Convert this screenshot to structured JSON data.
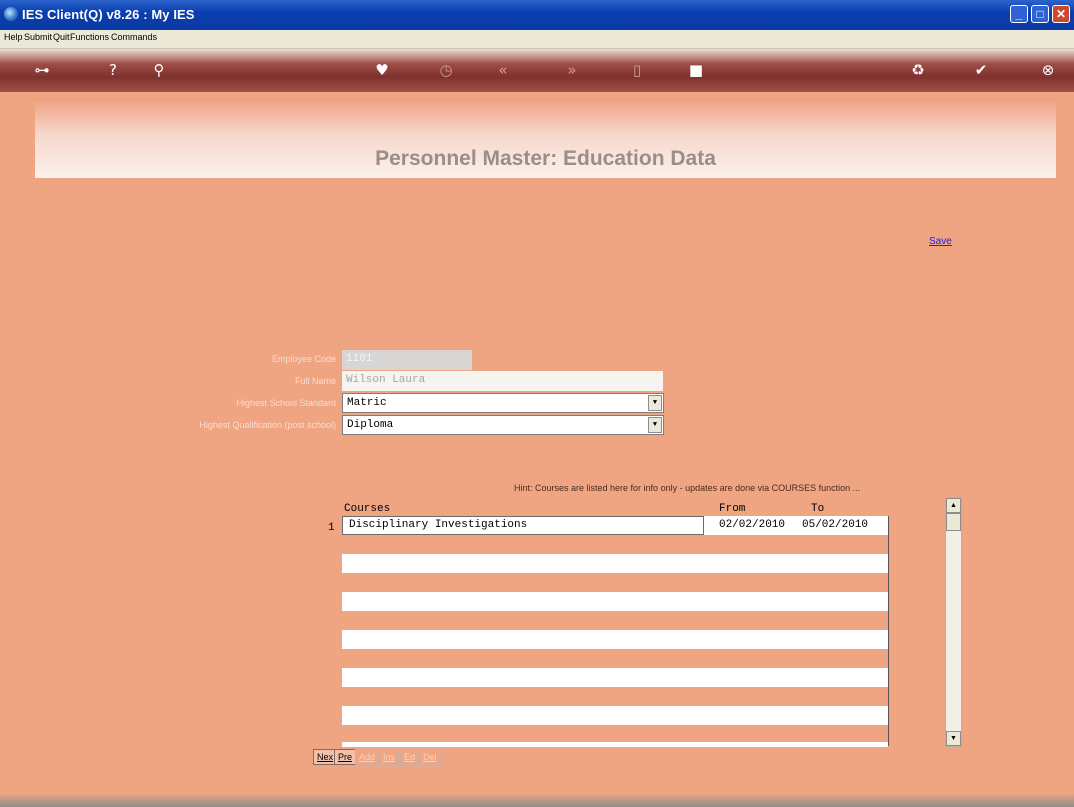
{
  "window": {
    "title": "IES Client(Q) v8.26 : My IES"
  },
  "menu": [
    "Help",
    "Submit",
    "Quit",
    "Functions",
    "Commands"
  ],
  "toolbar": {
    "icons": [
      "key-icon",
      "help-icon",
      "search-icon",
      "heart-icon",
      "clock-icon",
      "rewind-icon",
      "fast-forward-icon",
      "trash-icon",
      "document-icon",
      "recycle-icon",
      "check-icon",
      "close-circle-icon"
    ]
  },
  "page": {
    "title": "Personnel Master: Education Data",
    "save_label": "Save"
  },
  "form": {
    "employee_code_label": "Employee Code",
    "employee_code_value": "1101",
    "full_name_label": "Full Name",
    "full_name_value": "Wilson Laura",
    "school_label": "Highest School Standard",
    "school_value": "Matric",
    "qualification_label": "Highest Qualification (post school)",
    "qualification_value": "Diploma"
  },
  "courses": {
    "hint": "Hint: Courses are listed here for info only -  updates are done via COURSES function ...",
    "headers": {
      "course": "Courses",
      "from": "From",
      "to": "To"
    },
    "rows": [
      {
        "num": "1",
        "course": "Disciplinary Investigations",
        "from": "02/02/2010",
        "to": "05/02/2010"
      }
    ]
  },
  "nav_buttons": [
    {
      "label": "Nex",
      "state": "active"
    },
    {
      "label": "Pre",
      "state": "active"
    },
    {
      "label": "Add",
      "state": "disabled"
    },
    {
      "label": "Ins",
      "state": "disabled"
    },
    {
      "label": "Ed",
      "state": "disabled"
    },
    {
      "label": "Del",
      "state": "disabled"
    }
  ],
  "colors": {
    "background": "#efa582",
    "title_bar": "#0b3aa2",
    "link": "#1c24d6"
  }
}
